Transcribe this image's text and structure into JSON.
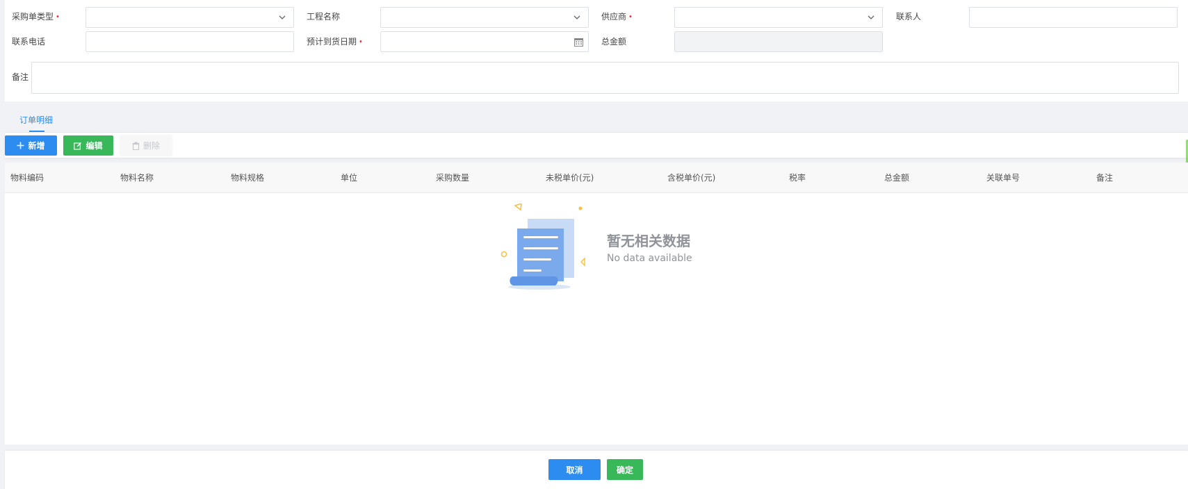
{
  "form": {
    "purchase_type": {
      "label": "采购单类型",
      "value": ""
    },
    "project_name": {
      "label": "工程名称",
      "value": ""
    },
    "supplier": {
      "label": "供应商",
      "value": ""
    },
    "contact_person": {
      "label": "联系人",
      "value": ""
    },
    "contact_phone": {
      "label": "联系电话",
      "value": ""
    },
    "expected_date": {
      "label": "预计到货日期",
      "value": ""
    },
    "total_amount": {
      "label": "总金额",
      "value": ""
    },
    "remark": {
      "label": "备注",
      "value": ""
    }
  },
  "tabs": [
    {
      "label": "订单明细",
      "active": true
    }
  ],
  "toolbar": {
    "add_label": "新增",
    "edit_label": "编辑",
    "delete_label": "删除"
  },
  "table": {
    "columns": [
      "物料编码",
      "物料名称",
      "物料规格",
      "单位",
      "采购数量",
      "未税单价(元)",
      "含税单价(元)",
      "税率",
      "总金额",
      "关联单号",
      "备注"
    ],
    "rows": []
  },
  "empty_state": {
    "title": "暂无相关数据",
    "subtitle": "No data available"
  },
  "footer": {
    "cancel_label": "取消",
    "confirm_label": "确定"
  },
  "colors": {
    "primary": "#2d8cf0",
    "success": "#38b859",
    "required": "#f5222d",
    "muted": "#909399"
  }
}
